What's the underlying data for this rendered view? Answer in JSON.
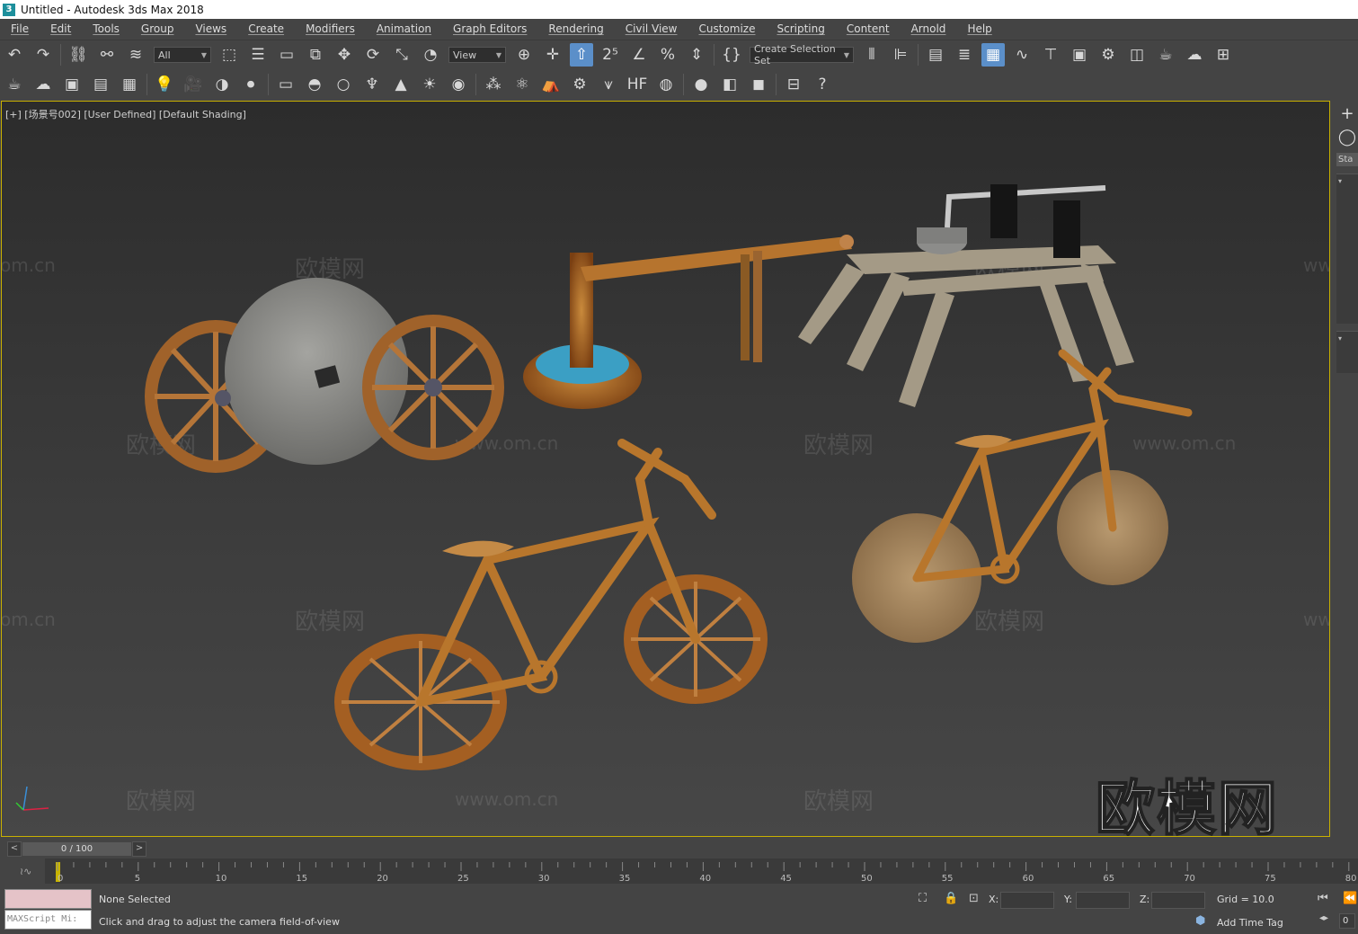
{
  "window": {
    "title": "Untitled - Autodesk 3ds Max 2018",
    "app_icon": "3"
  },
  "menu": [
    "File",
    "Edit",
    "Tools",
    "Group",
    "Views",
    "Create",
    "Modifiers",
    "Animation",
    "Graph Editors",
    "Rendering",
    "Civil View",
    "Customize",
    "Scripting",
    "Content",
    "Arnold",
    "Help"
  ],
  "toolbar": {
    "selection_filter": "All",
    "reference_coord": "View",
    "named_selection_placeholder": "Create Selection Set"
  },
  "viewport": {
    "label": "[+] [场景号002] [User Defined] [Default Shading]",
    "watermark_text": "欧模网",
    "watermark_url": "www.om.cn",
    "watermark_url_partial_left": "om.cn",
    "watermark_url_partial_right": "www.",
    "watermark_logo": "欧模网"
  },
  "command_panel": {
    "plus": "+",
    "tab": "Sta"
  },
  "time": {
    "frame": "0 / 100",
    "ticks": [
      "0",
      "5",
      "10",
      "15",
      "20",
      "25",
      "30",
      "35",
      "40",
      "45",
      "50",
      "55",
      "60",
      "65",
      "70",
      "75",
      "80"
    ]
  },
  "status": {
    "maxscript": "MAXScript Mi:",
    "selection": "None Selected",
    "prompt": "Click and drag to adjust the camera field-of-view",
    "x_label": "X:",
    "y_label": "Y:",
    "z_label": "Z:",
    "grid": "Grid = 10.0",
    "add_time_tag": "Add Time Tag",
    "frame_field": "0"
  }
}
